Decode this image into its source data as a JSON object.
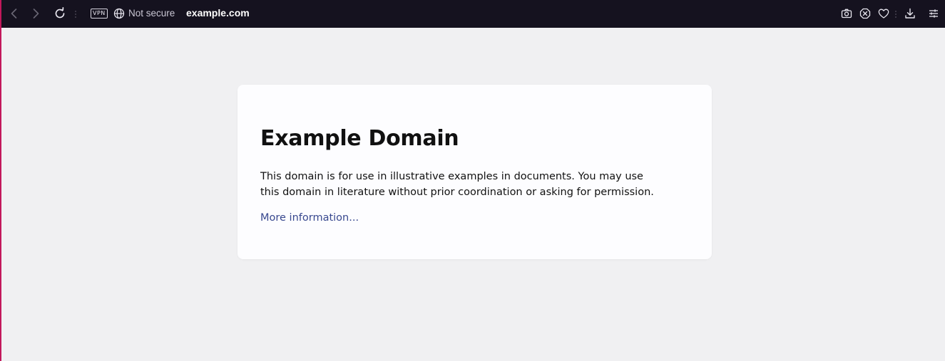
{
  "browser": {
    "vpn_badge": "VPN",
    "security_text": "Not secure",
    "url": "example.com",
    "icons": {
      "back": "back-arrow-icon",
      "forward": "forward-arrow-icon",
      "reload": "reload-icon",
      "globe": "globe-icon",
      "camera": "snapshot-camera-icon",
      "block": "ad-block-icon",
      "heart": "heart-icon",
      "download": "download-icon",
      "menu": "easy-setup-icon"
    }
  },
  "page": {
    "title": "Example Domain",
    "description": "This domain is for use in illustrative examples in documents. You may use this domain in literature without prior coordination or asking for permission.",
    "link_text": "More information..."
  },
  "colors": {
    "toolbar_bg": "#15121f",
    "page_bg": "#f0f0f2",
    "card_bg": "#fdfdff",
    "link": "#38488f",
    "accent_border": "#c2185b"
  }
}
